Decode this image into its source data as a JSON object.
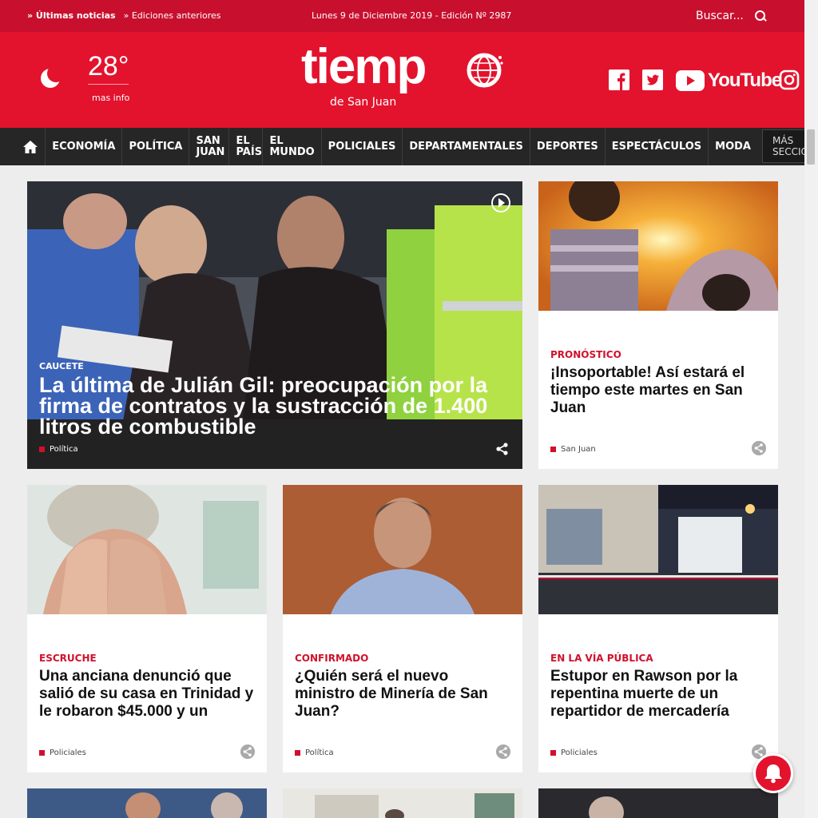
{
  "topbar": {
    "latest_news": "» Últimas noticias",
    "previous_editions": "» Ediciones anteriores",
    "date_edition": "Lunes 9 de Diciembre 2019 - Edición Nº 2987",
    "search_label": "Buscar..."
  },
  "weather": {
    "temperature": "28°",
    "more_info": "mas info"
  },
  "logo": {
    "word": "tiemp",
    "sub": "de San Juan"
  },
  "social": {
    "youtube_label": "YouTube"
  },
  "nav": {
    "items": [
      {
        "label": "ECONOMÍA"
      },
      {
        "label": "POLÍTICA"
      },
      {
        "label": "SAN JUAN"
      },
      {
        "label": "EL PAÍS"
      },
      {
        "label": "EL MUNDO"
      },
      {
        "label": "POLICIALES"
      },
      {
        "label": "DEPARTAMENTALES"
      },
      {
        "label": "DEPORTES"
      },
      {
        "label": "ESPECTÁCULOS"
      },
      {
        "label": "MODA"
      }
    ],
    "more": "MÁS SECCIONES"
  },
  "articles": [
    {
      "kicker": "CAUCETE",
      "title": "La última de Julián Gil: preocupación por la firma de contratos y la sustracción de 1.400 litros de combustible",
      "category": "Política"
    },
    {
      "kicker": "PRONÓSTICO",
      "title": "¡Insoportable! Así estará el tiempo este martes en San Juan",
      "category": "San Juan"
    },
    {
      "kicker": "ESCRUCHE",
      "title": "Una anciana denunció que salió de su casa en Trinidad y le robaron $45.000 y un",
      "category": "Policiales"
    },
    {
      "kicker": "CONFIRMADO",
      "title": "¿Quién será el nuevo ministro de Minería de San Juan?",
      "category": "Política"
    },
    {
      "kicker": "EN LA VÍA PÚBLICA",
      "title": "Estupor en Rawson por la repentina muerte de un repartidor de mercadería",
      "category": "Policiales"
    }
  ],
  "colors": {
    "brand_red": "#e3132d",
    "dark_red": "#c8102e",
    "nav_bg": "#262626"
  },
  "icons": [
    "search-icon",
    "moon-icon",
    "globe-icon",
    "facebook-icon",
    "twitter-icon",
    "youtube-icon",
    "instagram-icon",
    "home-icon",
    "share-icon",
    "bell-icon"
  ]
}
